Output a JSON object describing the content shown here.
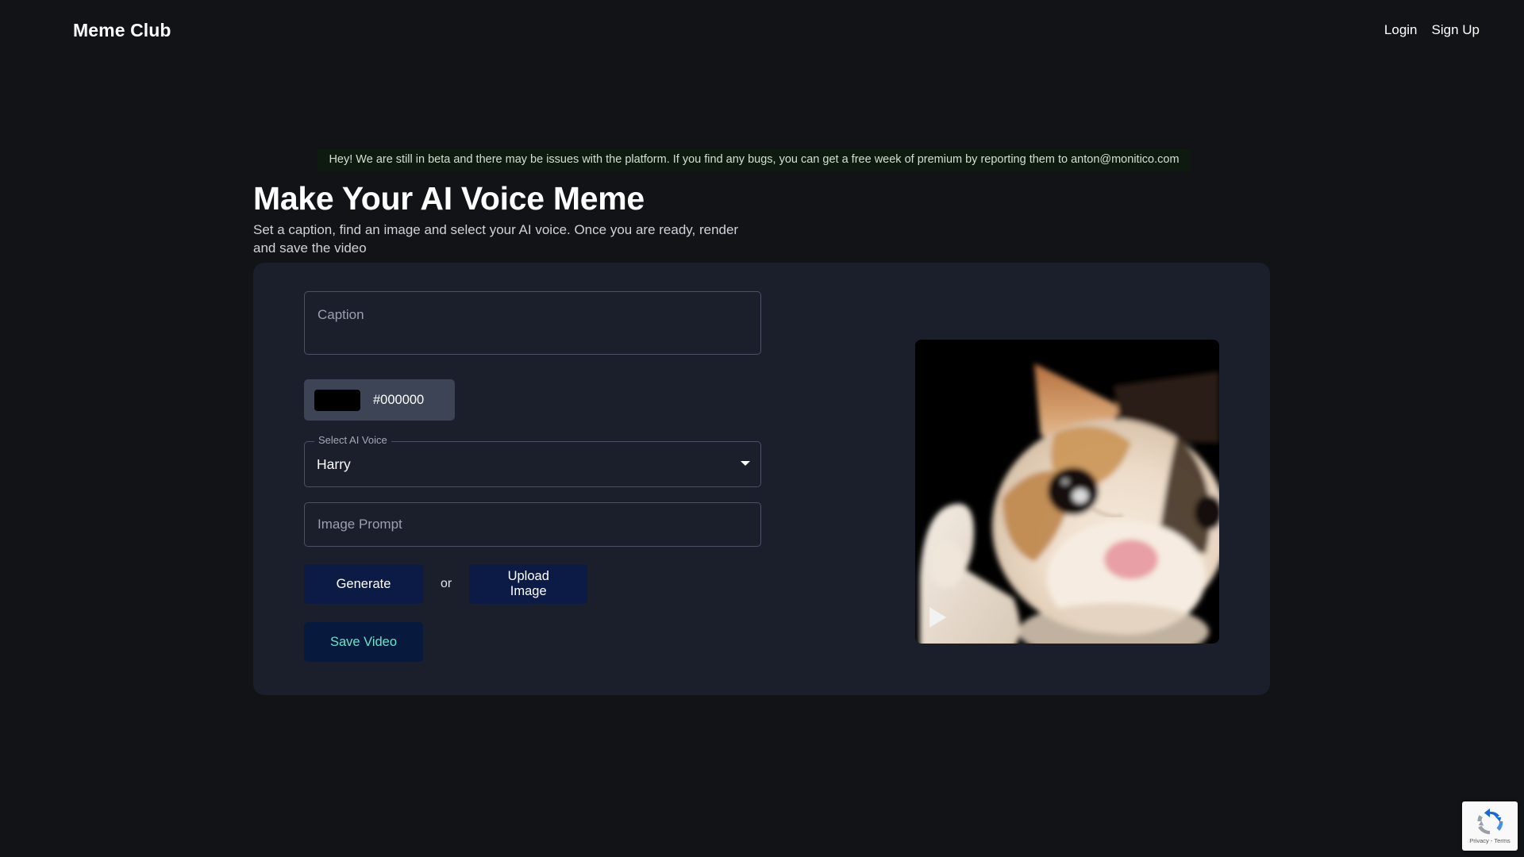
{
  "navbar": {
    "brand": "Meme Club",
    "links": [
      {
        "label": "Login",
        "name": "login-link"
      },
      {
        "label": "Sign Up",
        "name": "signup-link"
      }
    ]
  },
  "banner": {
    "text": "Hey! We are still in beta and there may be issues with the platform. If you find any bugs, you can get a free week of premium by reporting them to anton@monitico.com",
    "background": "#0e1a10",
    "color": "#cfe0d0"
  },
  "hero": {
    "title": "Make Your AI Voice Meme",
    "subtitle": "Set a caption, find an image and select your AI voice. Once you are ready, render and save the video"
  },
  "form": {
    "caption": {
      "placeholder": "Caption",
      "value": ""
    },
    "color": {
      "hex": "#000000",
      "swatch": "#000000"
    },
    "voice": {
      "legend": "Select AI Voice",
      "value": "Harry"
    },
    "image_prompt": {
      "placeholder": "Image Prompt",
      "value": ""
    },
    "generate_label": "Generate",
    "or_label": "or",
    "upload_label": "Upload Image",
    "save_label": "Save Video",
    "save_color": "#62e6c8",
    "button_background": "#0b1b45"
  },
  "preview": {
    "play_label": "play",
    "background": "#000000"
  },
  "recaptcha": {
    "text": "Privacy - Terms"
  },
  "theme": {
    "page_background": "#111317",
    "card_background": "#1b1e2b",
    "border": "#4a5164"
  }
}
